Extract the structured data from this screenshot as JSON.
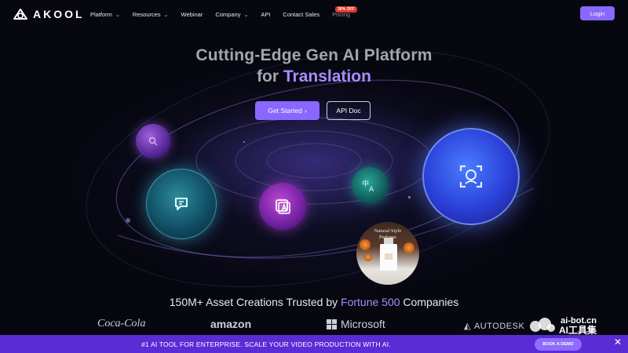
{
  "brand": {
    "logo_text": "AKOOL"
  },
  "nav": {
    "items": [
      {
        "label": "Platform",
        "has_dropdown": true
      },
      {
        "label": "Resources",
        "has_dropdown": true
      },
      {
        "label": "Webinar",
        "has_dropdown": false
      },
      {
        "label": "Company",
        "has_dropdown": true
      },
      {
        "label": "API",
        "has_dropdown": false
      },
      {
        "label": "Contact Sales",
        "has_dropdown": false
      }
    ],
    "pricing": {
      "label": "Pricing",
      "badge": "30% OFF"
    },
    "login_label": "Login"
  },
  "hero": {
    "title": "Cutting-Edge Gen AI Platform",
    "subtitle_prefix": "for ",
    "subtitle_accent": "Translation",
    "primary_button": "Get Started",
    "primary_button_icon": "›",
    "secondary_button": "API Doc"
  },
  "orbs": {
    "photo_caption_line1": "Natural Style",
    "photo_caption_line2": "Perfume"
  },
  "trust": {
    "prefix": "150M+ Asset Creations Trusted by ",
    "accent": "Fortune 500",
    "suffix": " Companies"
  },
  "customer_logos": [
    "Coca-Cola",
    "amazon",
    "Microsoft",
    "AUTODESK"
  ],
  "watermark": {
    "line1": "ai-bot.cn",
    "line2": "AI工具集"
  },
  "banner": {
    "text": "#1 AI TOOL FOR ENTERPRISE. SCALE YOUR VIDEO PRODUCTION WITH AI.",
    "button": "BOOK A DEMO",
    "close": "✕"
  },
  "colors": {
    "accent": "#8a67ff",
    "banner": "#5b2bd6",
    "badge": "#e03a2a"
  }
}
